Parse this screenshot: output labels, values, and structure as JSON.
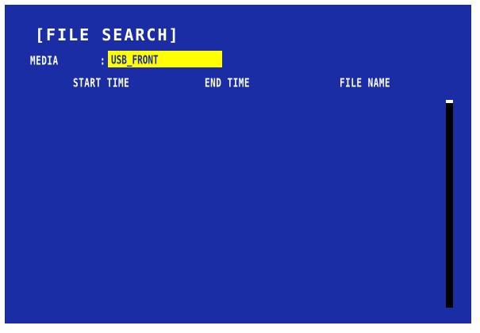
{
  "window": {
    "title": "[FILE SEARCH]"
  },
  "media": {
    "label": "MEDIA",
    "separator": ":",
    "value": "USB_FRONT",
    "highlight_color": "#ffff00"
  },
  "table": {
    "columns": [
      "START TIME",
      "END TIME",
      "FILE NAME"
    ],
    "rows": []
  },
  "colors": {
    "background": "#1a2da4",
    "text": "#ffffff",
    "scrollbar": "#000000"
  }
}
